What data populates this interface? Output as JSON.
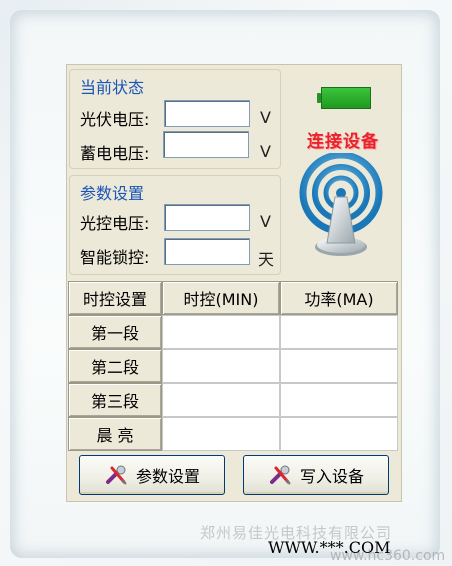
{
  "status_group": {
    "title": "当前状态",
    "pv_voltage_label": "光伏电压:",
    "pv_voltage_unit": "V",
    "battery_voltage_label": "蓄电电压:",
    "battery_voltage_unit": "V",
    "pv_voltage_value": "",
    "battery_voltage_value": ""
  },
  "params_group": {
    "title": "参数设置",
    "light_control_label": "光控电压:",
    "light_control_unit": "V",
    "smart_lock_label": "智能锁控:",
    "smart_lock_unit": "天",
    "light_control_value": "",
    "smart_lock_value": ""
  },
  "device": {
    "connect_label": "连接设备",
    "battery_color": "#2bb52b",
    "connect_color": "#e8242b"
  },
  "timer_table": {
    "headers": [
      "时控设置",
      "时控(MIN)",
      "功率(MA)"
    ],
    "rows": [
      {
        "label": "第一段",
        "minutes": "",
        "power": ""
      },
      {
        "label": "第二段",
        "minutes": "",
        "power": ""
      },
      {
        "label": "第三段",
        "minutes": "",
        "power": ""
      },
      {
        "label": "晨 亮",
        "minutes": "",
        "power": ""
      }
    ]
  },
  "buttons": {
    "params_label": "参数设置",
    "write_label": "写入设备",
    "params_icon": "wrench-screwdriver-icon",
    "write_icon": "wrench-screwdriver-icon"
  },
  "watermark": {
    "company": "郑州易佳光电科技有限公司",
    "url": "WWW.***.COM",
    "site": "www.hc360.com"
  }
}
